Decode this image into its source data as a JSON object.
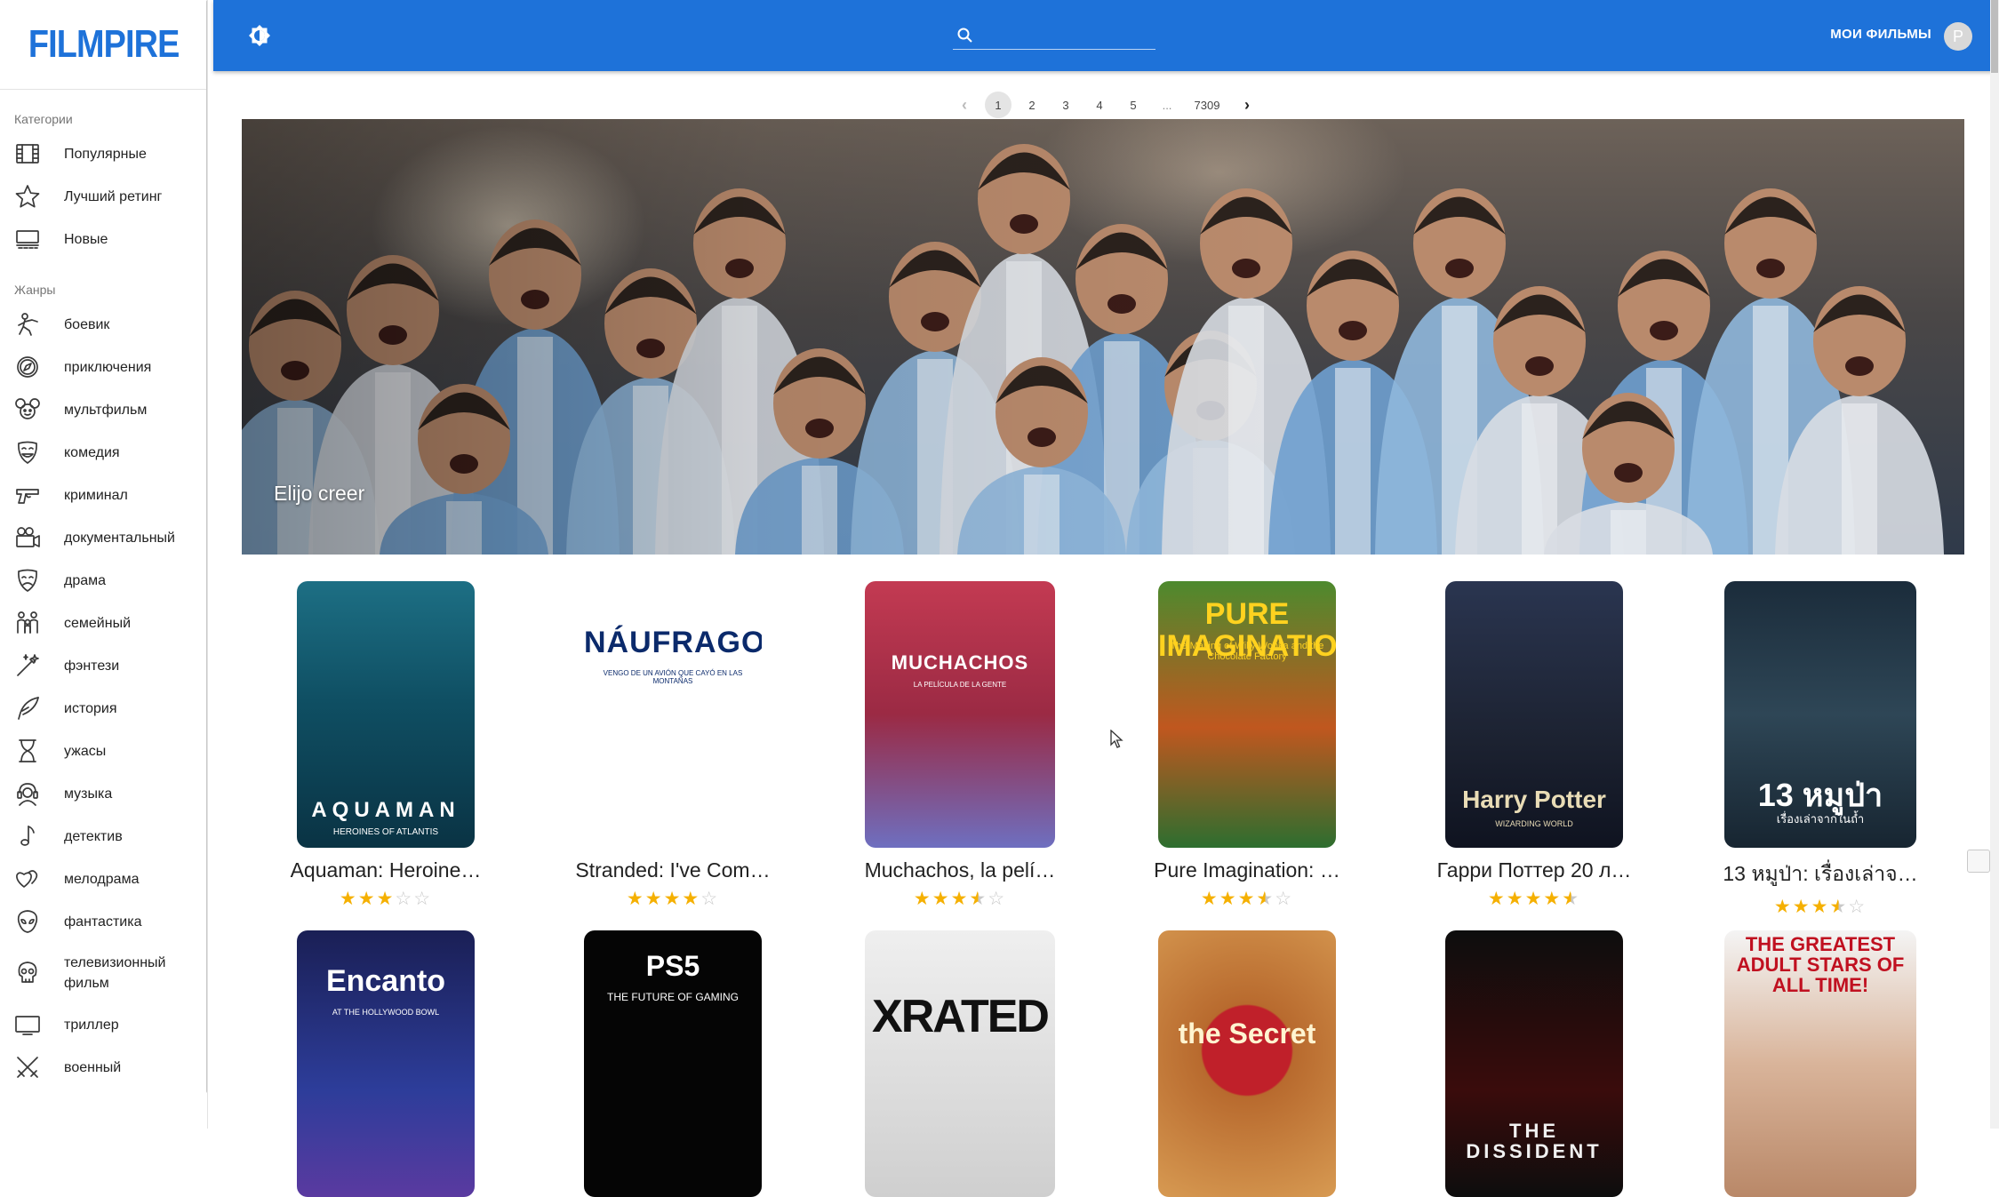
{
  "app": {
    "logo": "FILMPIRE"
  },
  "sidebar": {
    "categories_title": "Категории",
    "categories": [
      {
        "label": "Популярные",
        "icon": "film-icon"
      },
      {
        "label": "Лучший ретинг",
        "icon": "star-icon"
      },
      {
        "label": "Новые",
        "icon": "theater-icon"
      }
    ],
    "genres_title": "Жанры",
    "genres": [
      {
        "label": "боевик",
        "icon": "fighter-icon"
      },
      {
        "label": "приключения",
        "icon": "compass-icon"
      },
      {
        "label": "мультфильм",
        "icon": "mouse-ears-icon"
      },
      {
        "label": "комедия",
        "icon": "comedy-mask-icon"
      },
      {
        "label": "криминал",
        "icon": "pistol-icon"
      },
      {
        "label": "документальный",
        "icon": "video-camera-icon"
      },
      {
        "label": "драма",
        "icon": "drama-mask-icon"
      },
      {
        "label": "семейный",
        "icon": "family-icon"
      },
      {
        "label": "фэнтези",
        "icon": "magic-wand-icon"
      },
      {
        "label": "история",
        "icon": "quill-icon"
      },
      {
        "label": "ужасы",
        "icon": "hourglass-icon"
      },
      {
        "label": "музыка",
        "icon": "headphones-person-icon"
      },
      {
        "label": "детектив",
        "icon": "music-note-icon"
      },
      {
        "label": "мелодрама",
        "icon": "hearts-icon"
      },
      {
        "label": "фантастика",
        "icon": "alien-icon"
      },
      {
        "label": "телевизионный фильм",
        "icon": "skull-icon"
      },
      {
        "label": "триллер",
        "icon": "tv-icon"
      },
      {
        "label": "военный",
        "icon": "crossed-swords-icon"
      }
    ]
  },
  "topbar": {
    "theme_icon": "brightness-icon",
    "search_icon": "search-icon",
    "search_value": "",
    "my_films_label": "МОИ ФИЛЬМЫ",
    "avatar_letter": "P"
  },
  "pagination": {
    "pages": [
      "1",
      "2",
      "3",
      "4",
      "5"
    ],
    "dots": "...",
    "last": "7309",
    "current": "1"
  },
  "hero": {
    "title": "Elijo creer"
  },
  "movies": [
    {
      "title": "Aquaman: Heroine…",
      "rating": 3,
      "poster_text": "AQUAMAN",
      "poster_sub": "HEROINES OF ATLANTIS"
    },
    {
      "title": "Stranded: I've Com…",
      "rating": 4,
      "poster_text": "NÁUFRAGOS",
      "poster_sub": "VENGO DE UN AVIÓN QUE CAYÓ EN LAS MONTAÑAS"
    },
    {
      "title": "Muchachos, la pelí…",
      "rating": 3.5,
      "poster_text": "MUCHACHOS",
      "poster_sub": "LA PELÍCULA DE LA GENTE"
    },
    {
      "title": "Pure Imagination: …",
      "rating": 3.5,
      "poster_text": "PURE IMAGINATION",
      "poster_sub": "The Making of Willy Wonka and the Chocolate Factory"
    },
    {
      "title": "Гарри Поттер 20 л…",
      "rating": 4.5,
      "poster_text": "Harry Potter",
      "poster_sub": "WIZARDING WORLD"
    },
    {
      "title": "13 หมูป่า: เรื่องเล่าจ…",
      "rating": 3.5,
      "poster_text": "13 หมูป่า",
      "poster_sub": "เรื่องเล่าจากในถ้ำ"
    },
    {
      "title": "",
      "rating": 0,
      "poster_text": "Encanto",
      "poster_sub": "AT THE HOLLYWOOD BOWL"
    },
    {
      "title": "",
      "rating": 0,
      "poster_text": "PS5",
      "poster_sub": "THE FUTURE OF GAMING"
    },
    {
      "title": "",
      "rating": 0,
      "poster_text": "XRATED",
      "poster_sub": ""
    },
    {
      "title": "",
      "rating": 0,
      "poster_text": "the Secret",
      "poster_sub": ""
    },
    {
      "title": "",
      "rating": 0,
      "poster_text": "THE DISSIDENT",
      "poster_sub": ""
    },
    {
      "title": "",
      "rating": 0,
      "poster_text": "THE GREATEST ADULT STARS OF ALL TIME!",
      "poster_sub": ""
    }
  ],
  "colors": {
    "brand": "#1e72d9",
    "star": "#f5b000"
  }
}
